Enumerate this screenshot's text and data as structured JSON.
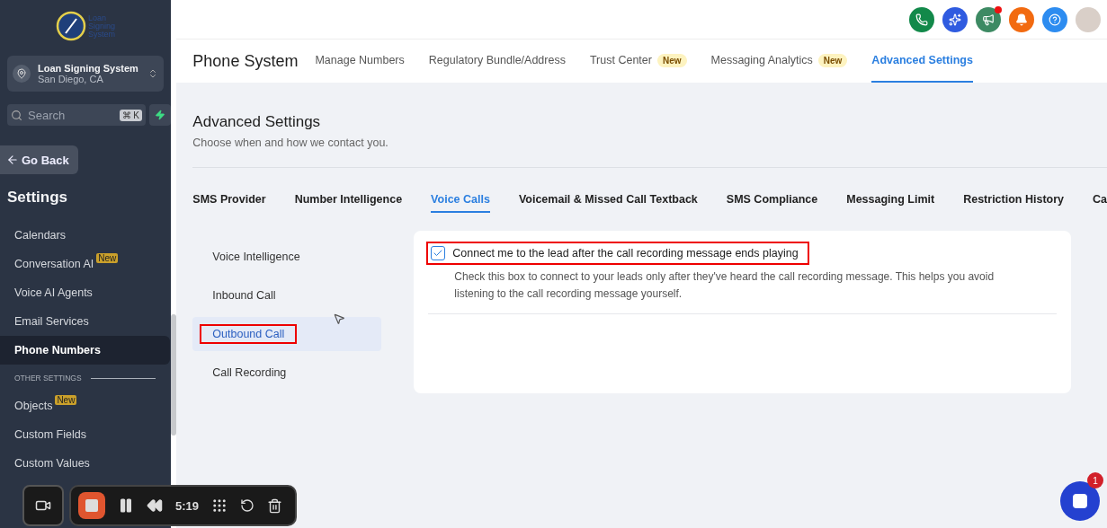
{
  "sidebar": {
    "logo_text": [
      "Loan",
      "Signing",
      "System"
    ],
    "account": {
      "name": "Loan Signing System",
      "location": "San Diego, CA"
    },
    "search": {
      "placeholder": "Search",
      "shortcut": "⌘ K"
    },
    "back_button": "Go Back",
    "title": "Settings",
    "items": [
      {
        "kind": "item",
        "label": "Calendars",
        "selected": false
      },
      {
        "kind": "item",
        "label": "Conversation AI",
        "badge": "New",
        "selected": false
      },
      {
        "kind": "item",
        "label": "Voice AI Agents",
        "selected": false
      },
      {
        "kind": "item",
        "label": "Email Services",
        "selected": false
      },
      {
        "kind": "item",
        "label": "Phone Numbers",
        "selected": true
      },
      {
        "kind": "section",
        "label": "OTHER SETTINGS"
      },
      {
        "kind": "item",
        "label": "Objects",
        "badge": "New",
        "selected": false
      },
      {
        "kind": "item",
        "label": "Custom Fields",
        "selected": false
      },
      {
        "kind": "item",
        "label": "Custom Values",
        "selected": false
      }
    ]
  },
  "topbar": {
    "notification_dot": true
  },
  "header": {
    "title": "Phone System",
    "tabs": [
      {
        "label": "Manage Numbers",
        "selected": false
      },
      {
        "label": "Regulatory Bundle/Address",
        "selected": false
      },
      {
        "label": "Trust Center",
        "badge": "New",
        "selected": false
      },
      {
        "label": "Messaging Analytics",
        "badge": "New",
        "selected": false
      },
      {
        "label": "Advanced Settings",
        "selected": true
      }
    ]
  },
  "page": {
    "title": "Advanced Settings",
    "subtitle": "Choose when and how we contact you.",
    "tabs": [
      {
        "label": "SMS Provider",
        "selected": false
      },
      {
        "label": "Number Intelligence",
        "selected": false
      },
      {
        "label": "Voice Calls",
        "selected": true
      },
      {
        "label": "Voicemail & Missed Call Textback",
        "selected": false
      },
      {
        "label": "SMS Compliance",
        "selected": false
      },
      {
        "label": "Messaging Limit",
        "selected": false
      },
      {
        "label": "Restriction History",
        "selected": false
      },
      {
        "label": "Ca",
        "selected": false
      }
    ],
    "menu": [
      {
        "label": "Voice Intelligence",
        "selected": false,
        "annotated": false
      },
      {
        "label": "Inbound Call",
        "selected": false,
        "annotated": false
      },
      {
        "label": "Outbound Call",
        "selected": true,
        "annotated": true
      },
      {
        "label": "Call Recording",
        "selected": false,
        "annotated": false
      }
    ],
    "option": {
      "label": "Connect me to the lead after the call recording message ends playing",
      "checked": true,
      "annotated": true,
      "description": "Check this box to connect to your leads only after they've heard the call recording message. This helps you avoid listening to the call recording message yourself."
    }
  },
  "recorder": {
    "time": "5:19"
  },
  "chat": {
    "badge": "1"
  }
}
